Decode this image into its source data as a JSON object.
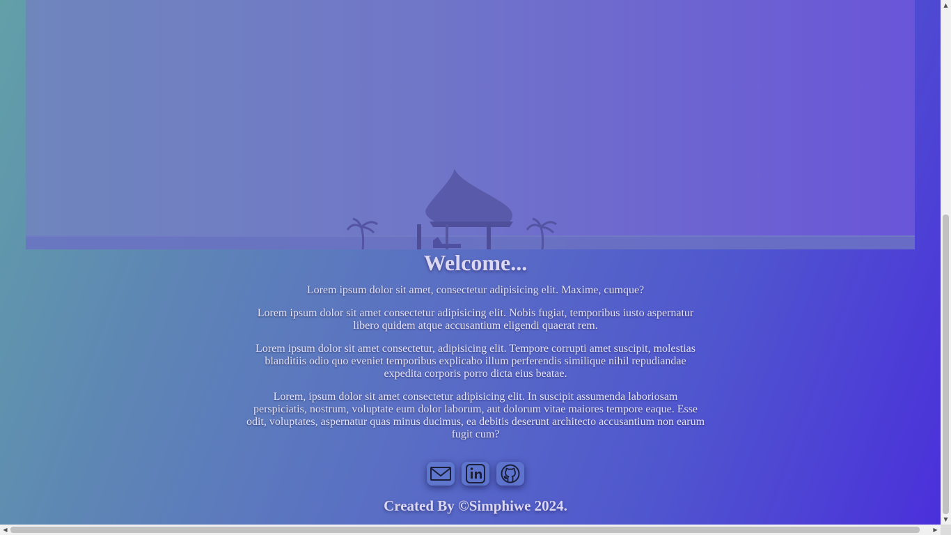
{
  "hero": {
    "image": "beach-gazebo-photo"
  },
  "main": {
    "title": "Welcome...",
    "paragraphs": [
      "Lorem ipsum dolor sit amet, consectetur adipisicing elit. Maxime, cumque?",
      "Lorem ipsum dolor sit amet consectetur adipisicing elit. Nobis fugiat, temporibus iusto aspernatur libero quidem atque accusantium eligendi quaerat rem.",
      "Lorem ipsum dolor sit amet consectetur, adipisicing elit. Tempore corrupti amet suscipit, molestias blanditiis odio quo eveniet temporibus explicabo illum perferendis similique nihil repudiandae expedita corporis porro dicta eius beatae.",
      "Lorem, ipsum dolor sit amet consectetur adipisicing elit. In suscipit assumenda laboriosam perspiciatis, nostrum, voluptate eum dolor laborum, aut dolorum vitae maiores tempore eaque. Esse odit, voluptates, aspernatur quas minus ducimus, ea debitis deserunt architecto accusantium non earum fugit cum?"
    ]
  },
  "socials": [
    {
      "icon": "mail-icon"
    },
    {
      "icon": "linkedin-icon"
    },
    {
      "icon": "github-icon"
    }
  ],
  "footer": {
    "text": "Created By ©Simphiwe 2024."
  },
  "scrollbars": {
    "arrow_up": "▲",
    "arrow_down": "▼",
    "arrow_left": "◀",
    "arrow_right": "▶"
  },
  "colors": {
    "accent": "#4a2edb",
    "icon_stroke": "#1c1f3a"
  }
}
